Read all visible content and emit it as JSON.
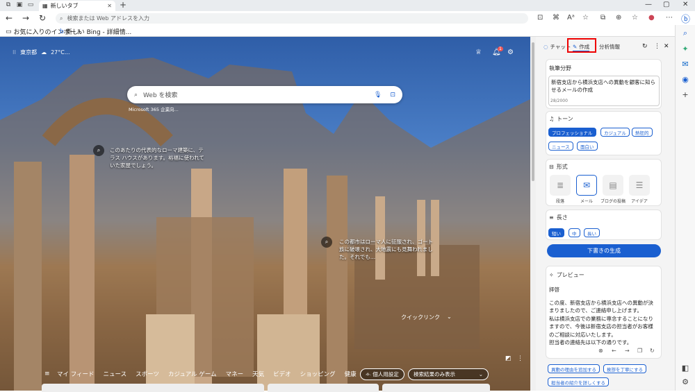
{
  "browser": {
    "tab_title": "新しいタブ",
    "address_placeholder": "検索または Web アドレスを入力",
    "favorites": [
      "お気に入りのインポート",
      "新しい Bing - 詳細情..."
    ]
  },
  "ntp": {
    "location": "東京都",
    "temperature": "27°C...",
    "notification_count": "1",
    "search_placeholder": "Web を検索",
    "search_sub": "Microsoft 365 企業向...",
    "note1": "このあたりの代表的なローマ建築に、テラス ハウスがあります。裕福に使われていた家屋でしょう。",
    "note2": "この都市はローマ人に征服され、ゴート族に破壊され、大地震にも見舞われました。それでも…",
    "quicklinks": "クイックリンク",
    "feed_tabs": [
      "マイ フィード",
      "ニュース",
      "スポーツ",
      "カジュアル ゲーム",
      "マネー",
      "天気",
      "ビデオ",
      "ショッピング",
      "健康"
    ],
    "more": "…",
    "personal": "個人用設定",
    "show_results": "検索結果のみ表示"
  },
  "pane": {
    "tabs": [
      "チャット",
      "作成",
      "分析情報"
    ],
    "topic_label": "執筆分野",
    "topic_text": "新宿支店から横浜支店への異動を顧客に知らせるメールの作成",
    "char_count": "28/2000",
    "tone_label": "トーン",
    "tones": [
      "プロフェッショナル",
      "カジュアル",
      "熱狂的",
      "ニュース",
      "面白い"
    ],
    "format_label": "形式",
    "formats": [
      "段落",
      "メール",
      "ブログの投稿",
      "アイデア"
    ],
    "length_label": "長さ",
    "lengths": [
      "短い",
      "中",
      "長い"
    ],
    "generate": "下書きの生成",
    "preview_label": "プレビュー",
    "preview_lines": [
      "拝啓",
      "この度、新宿支店から横浜支店への異動が決まりましたので、ご連絡申し上げます。",
      "私は横浜支店での業務に専念することになりますので、今後は新宿支店の担当者がお客様のご相談に対応いたします。",
      "担当者の連絡先は以下の通りです。"
    ],
    "suggestions": [
      "異動の理由を追加する",
      "挨拶を丁寧にする",
      "担当者の紹介を詳しくする"
    ]
  },
  "colors": {
    "accent": "#1a5fd0",
    "highlight": "#e00000"
  }
}
